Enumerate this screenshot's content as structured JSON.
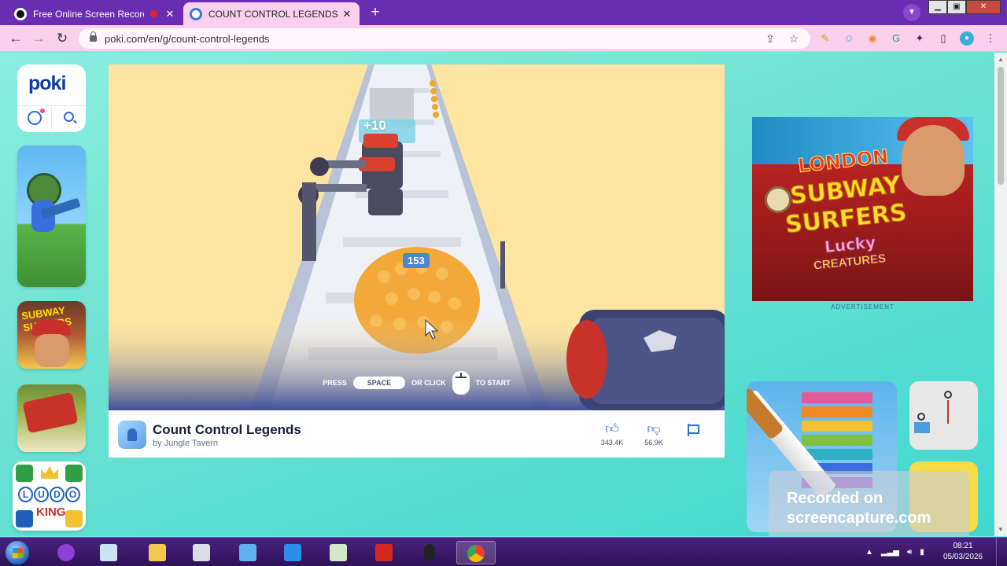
{
  "browser": {
    "tabs": [
      {
        "title": "Free Online Screen Recorder",
        "recording": true,
        "active": false
      },
      {
        "title": "COUNT CONTROL LEGENDS - Pla",
        "active": true
      }
    ],
    "new_tab_icon": "plus-icon",
    "url": "poki.com/en/g/count-control-legends",
    "colors": {
      "tabstrip": "#6a2cb0",
      "toolbar": "#fbd0ee"
    }
  },
  "sidebar": {
    "logo": "poki",
    "games": [
      {
        "name": "soldier-shooter-game"
      },
      {
        "name": "subway-surfers-game",
        "art_text": "SUBWAY SURFERS"
      },
      {
        "name": "harvester-farm-game"
      },
      {
        "name": "ludo-king-game",
        "art_text": [
          "L",
          "U",
          "D",
          "O",
          "KING"
        ]
      }
    ]
  },
  "game": {
    "title": "Count Control Legends",
    "developer": "by Jungle Tavern",
    "crowd_count": "153",
    "gate_label": "+10",
    "start_prompt": {
      "press": "PRESS",
      "key": "SPACE",
      "or_click": "OR CLICK",
      "to_start": "TO START"
    },
    "likes": "343.4K",
    "dislikes": "56.9K"
  },
  "advertisement": {
    "label": "ADVERTISEMENT",
    "art_lines": [
      "LONDON",
      "SUBWAY",
      "SURFERS",
      "Lucky",
      "CREATURES"
    ]
  },
  "watermark": {
    "line1": "Recorded on",
    "line2": "screencapture.com"
  },
  "taskbar": {
    "time": "08:21",
    "date": "05/03/2026",
    "apps": [
      "media-app",
      "notepad-app",
      "file-explorer-app",
      "calculator-app",
      "paint-app",
      "vscode-app",
      "sheet-app",
      "acrobat-app",
      "mouse-app",
      "chrome-app"
    ]
  }
}
